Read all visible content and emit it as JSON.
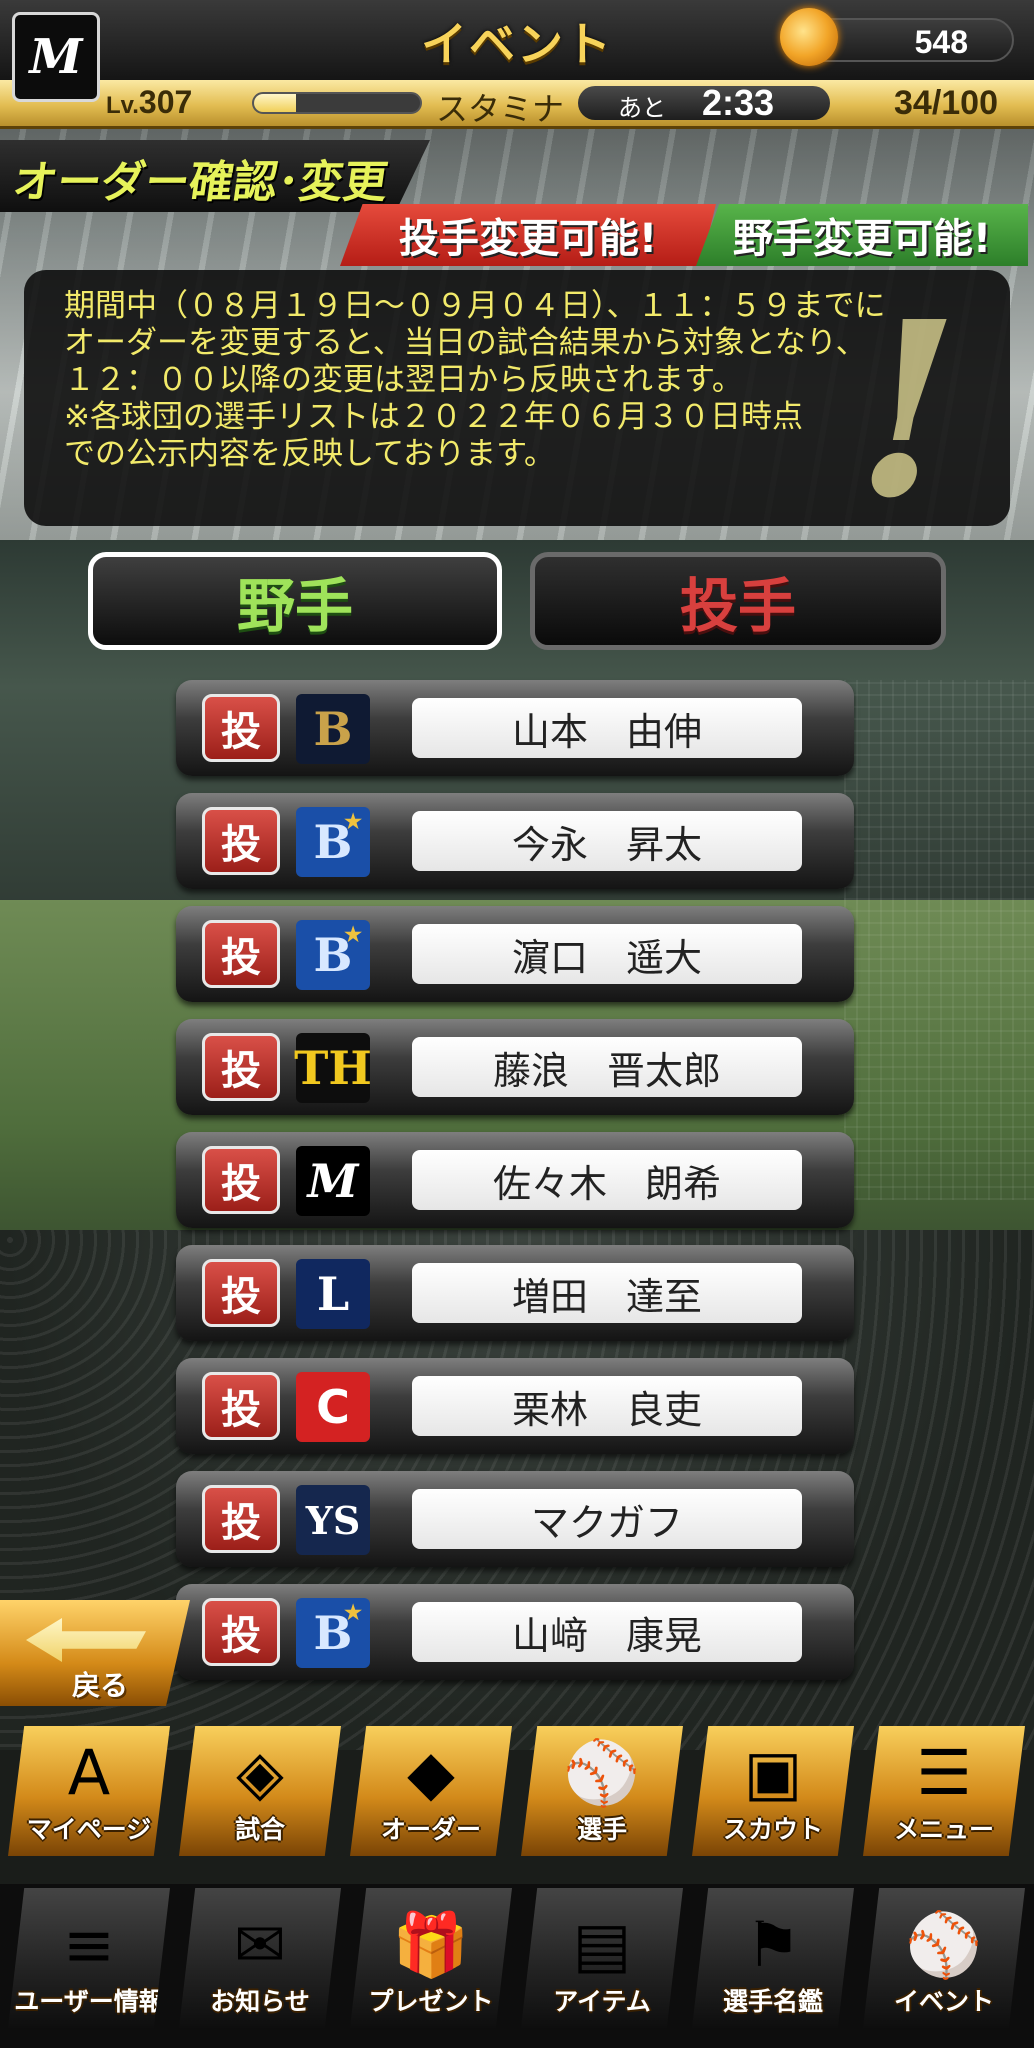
{
  "header": {
    "team_logo": "M",
    "title": "イベント",
    "coins": "548",
    "coin_icon": "flame-coin-icon",
    "level_prefix": "Lv.",
    "level": "307",
    "exp_progress": 0.25,
    "stamina_label": "スタミナ",
    "stamina_remaining_label": "あと",
    "stamina_timer": "2:33",
    "stamina_value": "34/100"
  },
  "order": {
    "title": "オーダー確認･変更",
    "pitcher_badge": "投手変更可能!",
    "fielder_badge": "野手変更可能!"
  },
  "notice": {
    "lines": [
      "期間中（０８月１９日～０９月０４日）、１１：５９までに",
      "オーダーを変更すると、当日の試合結果から対象となり、",
      "１２：００以降の変更は翌日から反映されます。",
      "※各球団の選手リストは２０２２年０６月３０日時点",
      "での公示内容を反映しております。"
    ]
  },
  "tabs": {
    "fielder": "野手",
    "pitcher": "投手"
  },
  "players": [
    {
      "position": "投",
      "team": "orix-buffaloes-logo",
      "team_mark": "B",
      "name": "山本　由伸"
    },
    {
      "position": "投",
      "team": "baystars-logo",
      "team_mark": "B",
      "name": "今永　昇太"
    },
    {
      "position": "投",
      "team": "baystars-logo",
      "team_mark": "B",
      "name": "濵口　遥大"
    },
    {
      "position": "投",
      "team": "tigers-logo",
      "team_mark": "TH",
      "name": "藤浪　晋太郎"
    },
    {
      "position": "投",
      "team": "marines-logo",
      "team_mark": "M",
      "name": "佐々木　朗希"
    },
    {
      "position": "投",
      "team": "lions-logo",
      "team_mark": "L",
      "name": "増田　達至"
    },
    {
      "position": "投",
      "team": "carp-logo",
      "team_mark": "C",
      "name": "栗林　良吏"
    },
    {
      "position": "投",
      "team": "swallows-logo",
      "team_mark": "YS",
      "name": "マクガフ"
    },
    {
      "position": "投",
      "team": "baystars-logo",
      "team_mark": "B",
      "name": "山﨑　康晃"
    }
  ],
  "back_button": {
    "label": "戻る"
  },
  "nav_main": [
    {
      "label": "マイページ",
      "icon": "mypage-icon",
      "glyph": "A"
    },
    {
      "label": "試合",
      "icon": "stadium-icon",
      "glyph": "◈"
    },
    {
      "label": "オーダー",
      "icon": "order-field-icon",
      "glyph": "◆"
    },
    {
      "label": "選手",
      "icon": "player-icon",
      "glyph": "⚾"
    },
    {
      "label": "スカウト",
      "icon": "scout-card-icon",
      "glyph": "▣"
    },
    {
      "label": "メニュー",
      "icon": "menu-icon",
      "glyph": "☰"
    }
  ],
  "nav_sub": [
    {
      "label": "ユーザー情報",
      "icon": "user-info-icon",
      "glyph": "≡"
    },
    {
      "label": "お知らせ",
      "icon": "notice-icon",
      "glyph": "✉"
    },
    {
      "label": "プレゼント",
      "icon": "present-icon",
      "glyph": "🎁"
    },
    {
      "label": "アイテム",
      "icon": "item-book-icon",
      "glyph": "▤"
    },
    {
      "label": "選手名鑑",
      "icon": "player-directory-icon",
      "glyph": "⚑"
    },
    {
      "label": "イベント",
      "icon": "event-icon",
      "glyph": "⚾"
    }
  ],
  "colors": {
    "accent_gold": "#f7d35a",
    "notice_text": "#f2ea6a",
    "pitcher_red": "#d8403e",
    "fielder_green": "#9fe35a"
  }
}
